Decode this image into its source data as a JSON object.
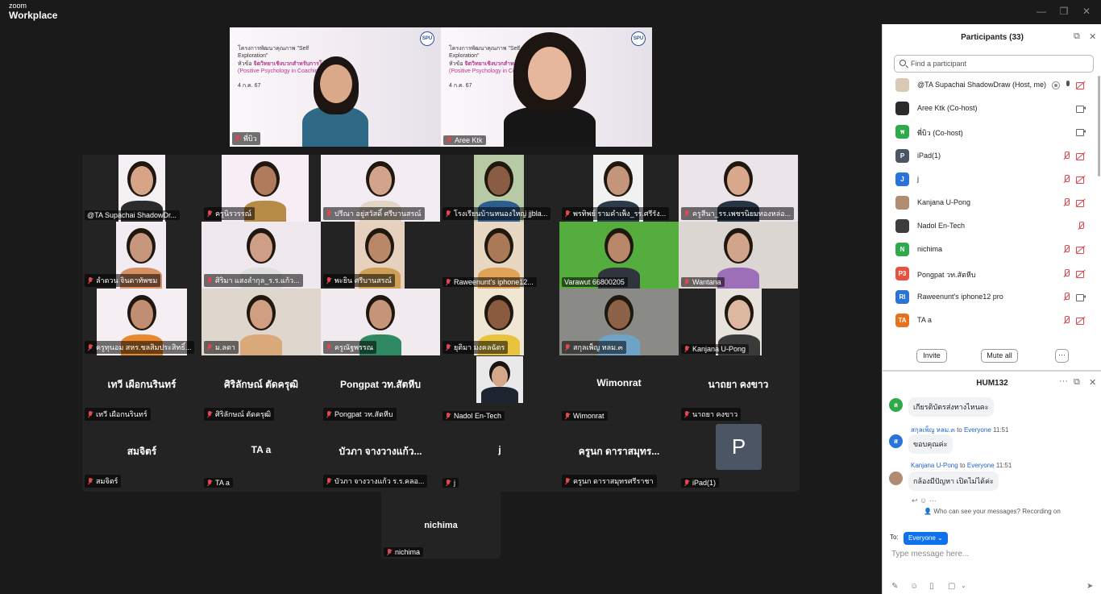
{
  "window": {
    "brand_small": "zoom",
    "brand_large": "Workplace",
    "min": "—",
    "max": "❐",
    "close": "✕"
  },
  "speakers": [
    {
      "name": "พี่บิว",
      "slide_title_line1": "โครงการพัฒนาคุณภาพ \"Self Exploration\"",
      "slide_title_line2": "หัวข้อ",
      "slide_title_accent": "จิตวิทยาเชิงบวกสำหรับการโค้ช",
      "slide_subtitle": "(Positive Psychology in Coaching)",
      "slide_date": "4 ก.ค. 67",
      "logo": "SPU"
    },
    {
      "name": "Aree  Ktk",
      "slide_title_line1": "โครงการพัฒนาคุณภาพ \"Self Exploration\"",
      "slide_title_line2": "หัวข้อ",
      "slide_title_accent": "จิตวิทยาเชิงบวกสำหรับการโค้ช",
      "slide_subtitle": "(Positive Psychology in Coaching)",
      "slide_date": "4 ก.ค. 67",
      "logo": "SPU"
    }
  ],
  "grid": [
    {
      "name": "@TA Supachai ShadowDr...",
      "muted": false
    },
    {
      "name": "ครูนิรวรรณ์",
      "muted": true
    },
    {
      "name": "ปรีณา อยู่สวัสดิ์ ศรีบานสรณ์",
      "muted": true
    },
    {
      "name": "โรงเรียนบ้านหนองใหญ่ jjbla...",
      "muted": true
    },
    {
      "name": "พรทิพย์ รามคำเพ็ง_รร.ศรีรัง...",
      "muted": true
    },
    {
      "name": "ครูสีนา_รร.เพชรนิยมทองหล่อ...",
      "muted": true
    },
    {
      "name": "ลำดวน จินดาทัพชม",
      "muted": true
    },
    {
      "name": "ศิริมา แสงลำกุล_ร.ร.แก้ว...",
      "muted": true
    },
    {
      "name": "พะยิน ศรีบานสรณ์",
      "muted": true
    },
    {
      "name": "Raweenunt's iphone12...",
      "muted": true
    },
    {
      "name": "Varawut 66800205",
      "muted": false
    },
    {
      "name": "Wantana",
      "muted": true
    },
    {
      "name": "ครูทุนอม สหร.ชลสิมประสิทธิ์...",
      "muted": true
    },
    {
      "name": "ม.ลดา",
      "muted": true
    },
    {
      "name": "ครูณัฐพรรณ",
      "muted": true
    },
    {
      "name": "ยุติมา มงคลฉัตร",
      "muted": true
    },
    {
      "name": "สกุลเพ็ญ หลม.๓",
      "muted": true
    },
    {
      "name": "Kanjana U-Pong",
      "muted": true
    },
    {
      "name": "เทวี เผือกนรินทร์",
      "muted": true,
      "display": "เทวี เผือกนรินทร์"
    },
    {
      "name": "ศิริลักษณ์ ตัดครุฒิ",
      "muted": true,
      "display": "ศิริลักษณ์ ตัดครุฒิ"
    },
    {
      "name": "Pongpat วท.สัตหีบ",
      "muted": true,
      "display": "Pongpat วท.สัตหีบ"
    },
    {
      "name": "Nadol En-Tech",
      "muted": true
    },
    {
      "name": "Wimonrat",
      "muted": true,
      "display": "Wimonrat"
    },
    {
      "name": "นาถยา คงขาว",
      "muted": true,
      "display": "นาถยา คงขาว"
    },
    {
      "name": "สมจิตร์",
      "muted": true,
      "display": "สมจิตร์"
    },
    {
      "name": "TA a",
      "muted": true,
      "display": "TA a"
    },
    {
      "name": "บัวภา จางวางแก้ว ร.ร.คลอ...",
      "muted": true,
      "display": "บัวภา จางวางแก้ว..."
    },
    {
      "name": "j",
      "muted": true,
      "display": "j"
    },
    {
      "name": "ครูนก ดาราสมุทรศรีราชา",
      "muted": true,
      "display": "ครูนก ดาราสมุทร..."
    },
    {
      "name": "iPad(1)",
      "muted": true,
      "avatar": "P"
    },
    {
      "name": "nichima",
      "muted": true,
      "display": "nichima"
    }
  ],
  "participants_panel": {
    "title": "Participants (33)",
    "search_placeholder": "Find a participant",
    "items": [
      {
        "name": "@TA Supachai ShadowDraw (Host, me)",
        "initial": "",
        "color": "#d9c8b4"
      },
      {
        "name": "Aree  Ktk (Co-host)",
        "initial": "",
        "color": "#2b2b2b"
      },
      {
        "name": "พี่บิว (Co-host)",
        "initial": "พ",
        "color": "#2eaa4a"
      },
      {
        "name": "iPad(1)",
        "initial": "P",
        "color": "#4b5563"
      },
      {
        "name": "j",
        "initial": "J",
        "color": "#2a73d9"
      },
      {
        "name": "Kanjana U-Pong",
        "initial": "",
        "color": "#b08c72"
      },
      {
        "name": "Nadol En-Tech",
        "initial": "",
        "color": "#3d3d3d"
      },
      {
        "name": "nichima",
        "initial": "N",
        "color": "#2eaa4a"
      },
      {
        "name": "Pongpat วท.สัตหีบ",
        "initial": "P3",
        "color": "#e5533d"
      },
      {
        "name": "Raweenunt's iphone12 pro",
        "initial": "RI",
        "color": "#2a73d9"
      },
      {
        "name": "TA a",
        "initial": "TA",
        "color": "#e8711c"
      }
    ],
    "invite": "Invite",
    "mute_all": "Mute all",
    "more": "···"
  },
  "chat": {
    "title": "HUM132",
    "messages": [
      {
        "sender": "",
        "to": "",
        "time": "",
        "text": "เกียรติบัตรส่งทางไหนคะ",
        "initial": "ล",
        "color": "#2eaa4a"
      },
      {
        "sender": "สกุลเพ็ญ หลม.๓",
        "to": "Everyone",
        "time": "11:51",
        "text": "ขอบคุณค่ะ",
        "initial": "ส",
        "color": "#2a73d9"
      },
      {
        "sender": "Kanjana U-Pong",
        "to": "Everyone",
        "time": "11:51",
        "text": "กล้องมีปัญหา เปิดไม่ได้ค่ะ",
        "initial": "",
        "color": "#b08c72"
      }
    ],
    "to_word": "to",
    "privacy_note": "Who can see your messages? Recording on",
    "to_label": "To:",
    "recipient": "Everyone",
    "input_placeholder": "Type message here..."
  }
}
